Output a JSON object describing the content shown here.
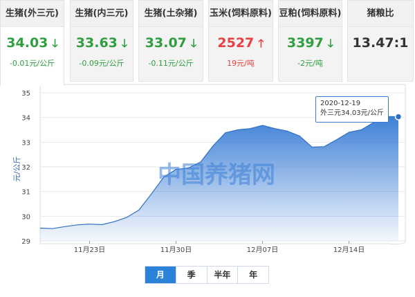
{
  "cards": [
    {
      "title": "生猪(外三元)",
      "price": "34.03",
      "direction": "down",
      "change": "-0.01元/公斤",
      "active": true
    },
    {
      "title": "生猪(内三元)",
      "price": "33.63",
      "direction": "down",
      "change": "-0.09元/公斤",
      "active": false
    },
    {
      "title": "生猪(土杂猪)",
      "price": "33.07",
      "direction": "down",
      "change": "-0.11元/公斤",
      "active": false
    },
    {
      "title": "玉米(饲料原料)",
      "price": "2527",
      "direction": "up",
      "change": "19元/吨",
      "active": false
    },
    {
      "title": "豆粕(饲料原料)",
      "price": "3397",
      "direction": "down",
      "change": "-2元/吨",
      "active": false
    },
    {
      "title": "猪粮比",
      "price": "13.47:1",
      "direction": "none",
      "change": "",
      "active": false
    }
  ],
  "colors": {
    "down": "#2e9e3e",
    "up": "#e84040",
    "area_top": "#3d7fd6",
    "line": "#2f6fc4",
    "tab_active": "#2b82d9"
  },
  "watermark": "中国养猪网",
  "tooltip": {
    "date": "2020-12-19",
    "text": "外三元34.03元/公斤"
  },
  "period_tabs": [
    {
      "label": "月",
      "active": true
    },
    {
      "label": "季",
      "active": false
    },
    {
      "label": "半年",
      "active": false
    },
    {
      "label": "年",
      "active": false
    }
  ],
  "chart_data": {
    "type": "area",
    "ylabel": "元/公斤",
    "ylim": [
      29,
      35
    ],
    "yticks": [
      29,
      30,
      31,
      32,
      33,
      34,
      35
    ],
    "xtick_labels": [
      "11月23日",
      "11月30日",
      "12月07日",
      "12月14日"
    ],
    "xtick_days": [
      4,
      11,
      18,
      25
    ],
    "grid": true,
    "series": [
      {
        "name": "外三元",
        "x_days": [
          0,
          1,
          2,
          3,
          4,
          5,
          6,
          7,
          8,
          9,
          10,
          11,
          12,
          13,
          14,
          15,
          16,
          17,
          18,
          19,
          20,
          21,
          22,
          23,
          24,
          25,
          26,
          27,
          28,
          29
        ],
        "values": [
          29.52,
          29.5,
          29.58,
          29.65,
          29.68,
          29.66,
          29.78,
          29.95,
          30.25,
          30.9,
          31.58,
          31.9,
          31.95,
          32.2,
          32.85,
          33.38,
          33.5,
          33.55,
          33.68,
          33.55,
          33.45,
          33.25,
          32.8,
          32.82,
          33.1,
          33.4,
          33.5,
          33.8,
          34.04,
          34.03
        ]
      }
    ]
  }
}
